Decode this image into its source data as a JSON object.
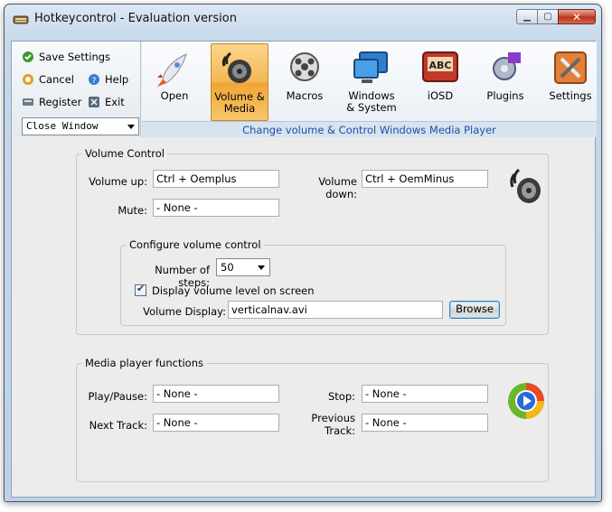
{
  "window": {
    "title": "Hotkeycontrol - Evaluation version"
  },
  "left_panel": {
    "save_settings": "Save Settings",
    "cancel": "Cancel",
    "help": "Help",
    "register": "Register",
    "exit": "Exit",
    "profile_selected": "Close Window"
  },
  "toolbar": {
    "items": [
      {
        "label": "Open",
        "icon": "rocket-icon"
      },
      {
        "label": "Volume &",
        "label2": "Media",
        "icon": "speaker-icon",
        "active": true
      },
      {
        "label": "Macros",
        "icon": "film-reel-icon"
      },
      {
        "label": "Windows",
        "label2": "& System",
        "icon": "monitor-icon"
      },
      {
        "label": "iOSD",
        "icon": "abc-display-icon"
      },
      {
        "label": "Plugins",
        "icon": "puzzle-gear-icon"
      },
      {
        "label": "Settings",
        "icon": "tools-icon"
      }
    ],
    "status": "Change volume & Control Windows Media Player"
  },
  "volume_control": {
    "title": "Volume Control",
    "volume_up_label": "Volume up:",
    "volume_up_value": "Ctrl + Oemplus",
    "volume_down_label": "Volume down:",
    "volume_down_value": "Ctrl + OemMinus",
    "mute_label": "Mute:",
    "mute_value": "- None -",
    "configure": {
      "title": "Configure volume control",
      "steps_label": "Number of steps:",
      "steps_value": "50",
      "display_checkbox_label": "Display volume level on screen",
      "display_checked": true,
      "volume_display_label": "Volume Display:",
      "volume_display_value": "verticalnav.avi",
      "browse": "Browse"
    }
  },
  "media_player": {
    "title": "Media player functions",
    "play_pause_label": "Play/Pause:",
    "play_pause_value": "- None -",
    "stop_label": "Stop:",
    "stop_value": "- None -",
    "next_label": "Next Track:",
    "next_value": "- None -",
    "previous_label": "Previous",
    "previous_label2": "Track:",
    "previous_value": "- None -"
  },
  "colors": {
    "accent": "#1f4fa8",
    "active_tab": "#f4b654"
  }
}
